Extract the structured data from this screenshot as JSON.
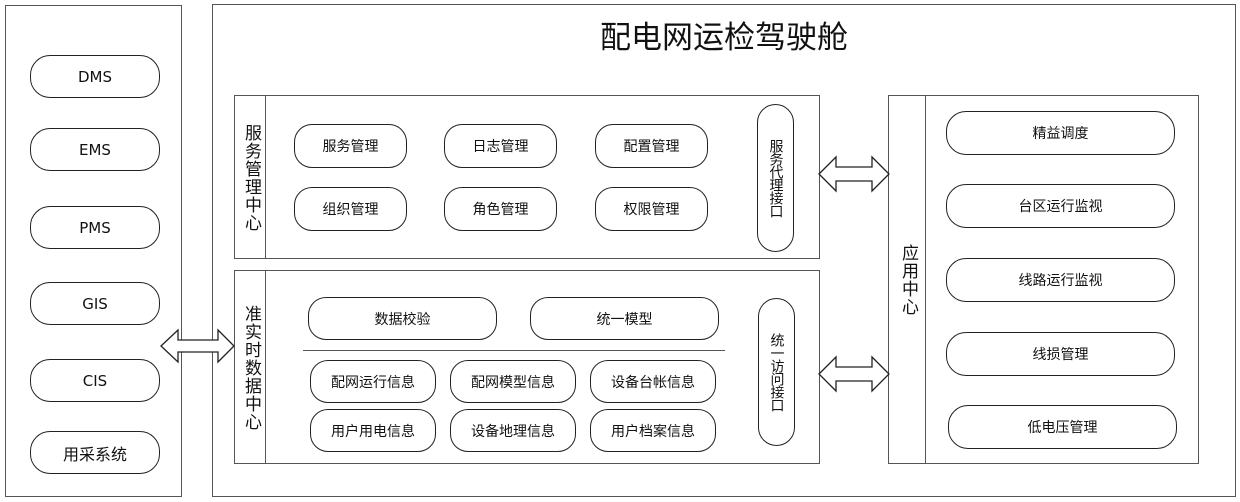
{
  "title": "配电网运检驾驶舱",
  "source_systems": [
    "DMS",
    "EMS",
    "PMS",
    "GIS",
    "CIS",
    "用采系统"
  ],
  "service_center": {
    "label": "服务管理中心",
    "items": [
      "服务管理",
      "日志管理",
      "配置管理",
      "组织管理",
      "角色管理",
      "权限管理"
    ],
    "interface": "服务代理接口"
  },
  "data_center": {
    "label": "准实时数据中心",
    "top_items": [
      "数据校验",
      "统一模型"
    ],
    "info_items": [
      "配网运行信息",
      "配网模型信息",
      "设备台帐信息",
      "用户用电信息",
      "设备地理信息",
      "用户档案信息"
    ],
    "interface": "统一访问接口"
  },
  "app_center": {
    "label": "应用中心",
    "items": [
      "精益调度",
      "台区运行监视",
      "线路运行监视",
      "线损管理",
      "低电压管理"
    ]
  },
  "arrows": [
    {
      "name": "source-to-data-arrow",
      "direction": "bidirectional"
    },
    {
      "name": "service-to-app-arrow",
      "direction": "bidirectional"
    },
    {
      "name": "data-to-app-arrow",
      "direction": "bidirectional"
    }
  ]
}
